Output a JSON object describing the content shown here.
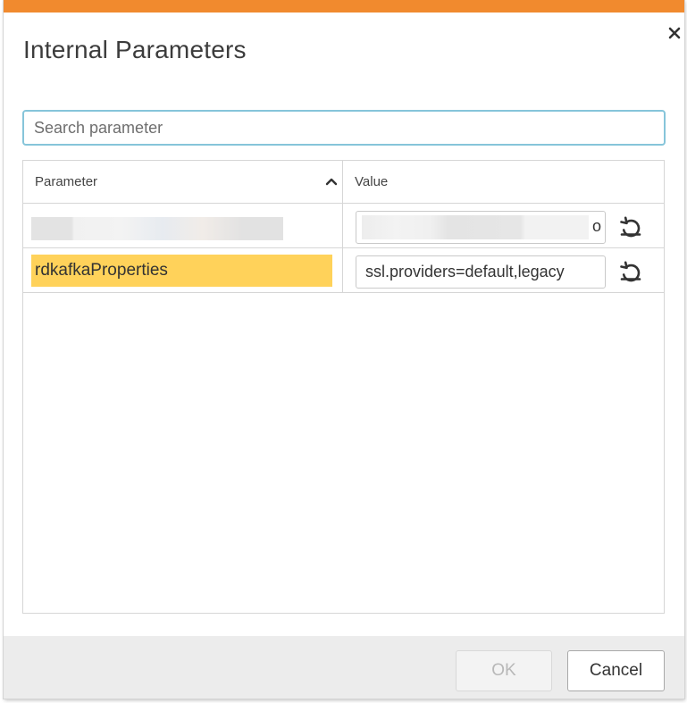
{
  "dialog": {
    "title": "Internal Parameters",
    "accent_color": "#f18a2e",
    "close_icon": "close-icon"
  },
  "search": {
    "placeholder": "Search parameter",
    "value": ""
  },
  "grid": {
    "columns": [
      {
        "label": "Parameter",
        "sorted": "ascending",
        "sort_icon": "chevron-up-icon"
      },
      {
        "label": "Value"
      }
    ],
    "rows": [
      {
        "parameter": "",
        "parameter_obscured": true,
        "value": "",
        "value_visible_tail": "o",
        "value_obscured": true,
        "action_icon": "reset-icon"
      },
      {
        "parameter": "rdkafkaProperties",
        "highlighted": true,
        "highlight_color": "#ffd25a",
        "value": "ssl.providers=default,legacy",
        "action_icon": "reset-icon"
      }
    ]
  },
  "footer": {
    "ok_label": "OK",
    "ok_enabled": false,
    "cancel_label": "Cancel"
  }
}
